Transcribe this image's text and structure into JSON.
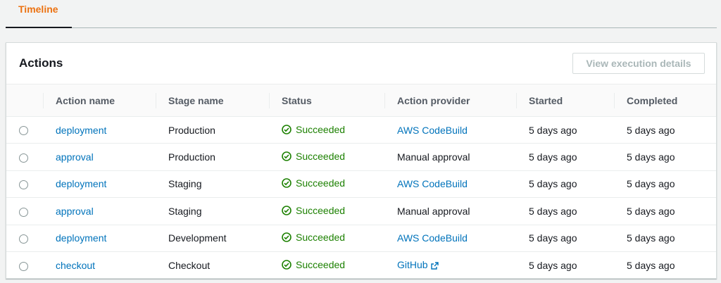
{
  "tabs": [
    {
      "label": "Timeline"
    }
  ],
  "panel": {
    "title": "Actions",
    "button_label": "View execution details"
  },
  "columns": [
    "Action name",
    "Stage name",
    "Status",
    "Action provider",
    "Started",
    "Completed"
  ],
  "rows": [
    {
      "action": "deployment",
      "stage": "Production",
      "status": "Succeeded",
      "provider": "AWS CodeBuild",
      "provider_link": true,
      "provider_external": false,
      "started": "5 days ago",
      "completed": "5 days ago"
    },
    {
      "action": "approval",
      "stage": "Production",
      "status": "Succeeded",
      "provider": "Manual approval",
      "provider_link": false,
      "provider_external": false,
      "started": "5 days ago",
      "completed": "5 days ago"
    },
    {
      "action": "deployment",
      "stage": "Staging",
      "status": "Succeeded",
      "provider": "AWS CodeBuild",
      "provider_link": true,
      "provider_external": false,
      "started": "5 days ago",
      "completed": "5 days ago"
    },
    {
      "action": "approval",
      "stage": "Staging",
      "status": "Succeeded",
      "provider": "Manual approval",
      "provider_link": false,
      "provider_external": false,
      "started": "5 days ago",
      "completed": "5 days ago"
    },
    {
      "action": "deployment",
      "stage": "Development",
      "status": "Succeeded",
      "provider": "AWS CodeBuild",
      "provider_link": true,
      "provider_external": false,
      "started": "5 days ago",
      "completed": "5 days ago"
    },
    {
      "action": "checkout",
      "stage": "Checkout",
      "status": "Succeeded",
      "provider": "GitHub",
      "provider_link": true,
      "provider_external": true,
      "started": "5 days ago",
      "completed": "5 days ago"
    }
  ],
  "colors": {
    "accent": "#ec7211",
    "link": "#0073bb",
    "success": "#1d8102"
  },
  "icons": {
    "status": "check-circle-icon",
    "external": "external-link-icon"
  }
}
